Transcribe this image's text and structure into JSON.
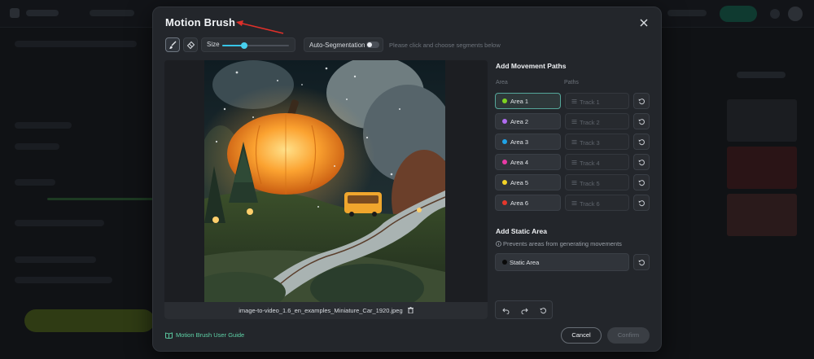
{
  "modal": {
    "title": "Motion Brush",
    "close_icon": "close-icon",
    "arrow_icon": "red-arrow-annotation-icon"
  },
  "toolbar": {
    "brush_icon": "brush-icon",
    "eraser_icon": "eraser-icon",
    "size_label": "Size",
    "size_value_fraction": 0.33,
    "size_slider_color": "#37c4e6",
    "autoseg_label": "Auto-Segmentation",
    "autoseg_on": false,
    "hint": "Please click and choose segments below"
  },
  "image": {
    "filename": "image-to-video_1.6_en_examples_Miniature_Car_1920.jpeg",
    "trash_icon": "trash-icon"
  },
  "movement": {
    "title": "Add Movement Paths",
    "area_header": "Area",
    "paths_header": "Paths",
    "rows": [
      {
        "area": "Area 1",
        "track": "Track 1",
        "color": "#7ed321",
        "selected": true
      },
      {
        "area": "Area 2",
        "track": "Track 2",
        "color": "#b06cf0"
      },
      {
        "area": "Area 3",
        "track": "Track 3",
        "color": "#1fa3e8"
      },
      {
        "area": "Area 4",
        "track": "Track 4",
        "color": "#e83aa6"
      },
      {
        "area": "Area 5",
        "track": "Track 5",
        "color": "#f3d327"
      },
      {
        "area": "Area 6",
        "track": "Track 6",
        "color": "#e5372c"
      }
    ]
  },
  "static_area": {
    "title": "Add Static Area",
    "note": "Prevents areas from generating movements",
    "info_icon": "info-icon",
    "label": "Static Area",
    "color": "#0a0a0a"
  },
  "history": {
    "undo_icon": "undo-icon",
    "redo_icon": "redo-icon",
    "reset_icon": "reset-icon"
  },
  "footer": {
    "guide_label": "Motion Brush User Guide",
    "guide_icon": "book-icon",
    "cancel_label": "Cancel",
    "confirm_label": "Confirm"
  }
}
